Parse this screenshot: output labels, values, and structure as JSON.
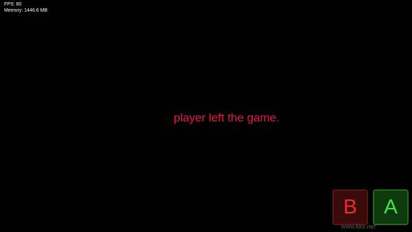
{
  "debug": {
    "fps": "FPS: 60",
    "memory": "Memory: 1446.6 MB"
  },
  "message": "player left the game.",
  "controls": {
    "b_label": "B",
    "a_label": "A"
  },
  "watermark": "www.kkx.net",
  "colors": {
    "background": "#000000",
    "message": "#e8194a",
    "button_b": "#ef2b2b",
    "button_a": "#4ae04a"
  }
}
